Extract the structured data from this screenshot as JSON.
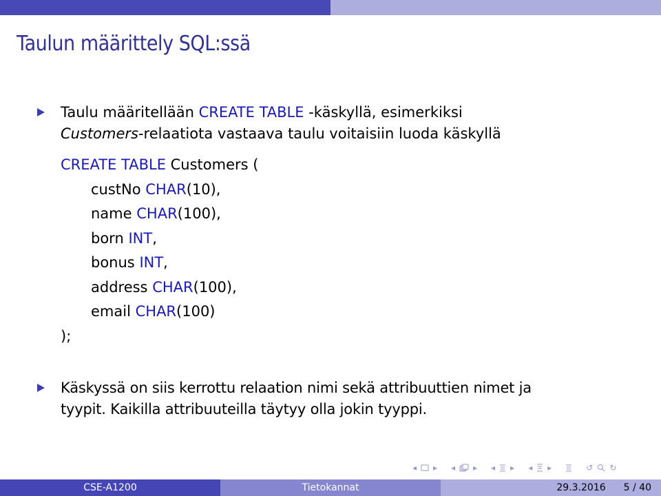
{
  "slide": {
    "title": "Taulun määrittely SQL:ssä",
    "bullet1": {
      "pre": "Taulu määritellään ",
      "keyword": "CREATE TABLE",
      "post": " -käskyllä, esimerkiksi",
      "line2_italic": "Customers",
      "line2_rest": "-relaatiota vastaava taulu voitaisiin luoda käskyllä"
    },
    "code": {
      "header_keyword": "CREATE TABLE",
      "header_rest": " Customers (",
      "columns": [
        {
          "name": "custNo",
          "type": "CHAR",
          "args": "(10),"
        },
        {
          "name": "name",
          "type": "CHAR",
          "args": "(100),"
        },
        {
          "name": "born",
          "type": "INT",
          "args": ","
        },
        {
          "name": "bonus",
          "type": "INT",
          "args": ","
        },
        {
          "name": "address",
          "type": "CHAR",
          "args": "(100),"
        },
        {
          "name": "email",
          "type": "CHAR",
          "args": "(100)"
        }
      ],
      "closing": ");"
    },
    "bullet2": {
      "line1": "Käskyssä on siis kerrottu relaation nimi sekä attribuuttien nimet ja",
      "line2": "tyypit. Kaikilla attribuuteilla täytyy olla jokin tyyppi."
    }
  },
  "footer": {
    "course": "CSE-A1200",
    "subject": "Tietokannat",
    "date": "29.3.2016",
    "page": "5 / 40"
  },
  "colors": {
    "title": "#32328f",
    "keyword": "#1a1ab3",
    "bullet": "#3d3db3",
    "bar_dark": "#4545b5",
    "bar_mid": "#8585d0",
    "bar_light": "#adaddf"
  }
}
